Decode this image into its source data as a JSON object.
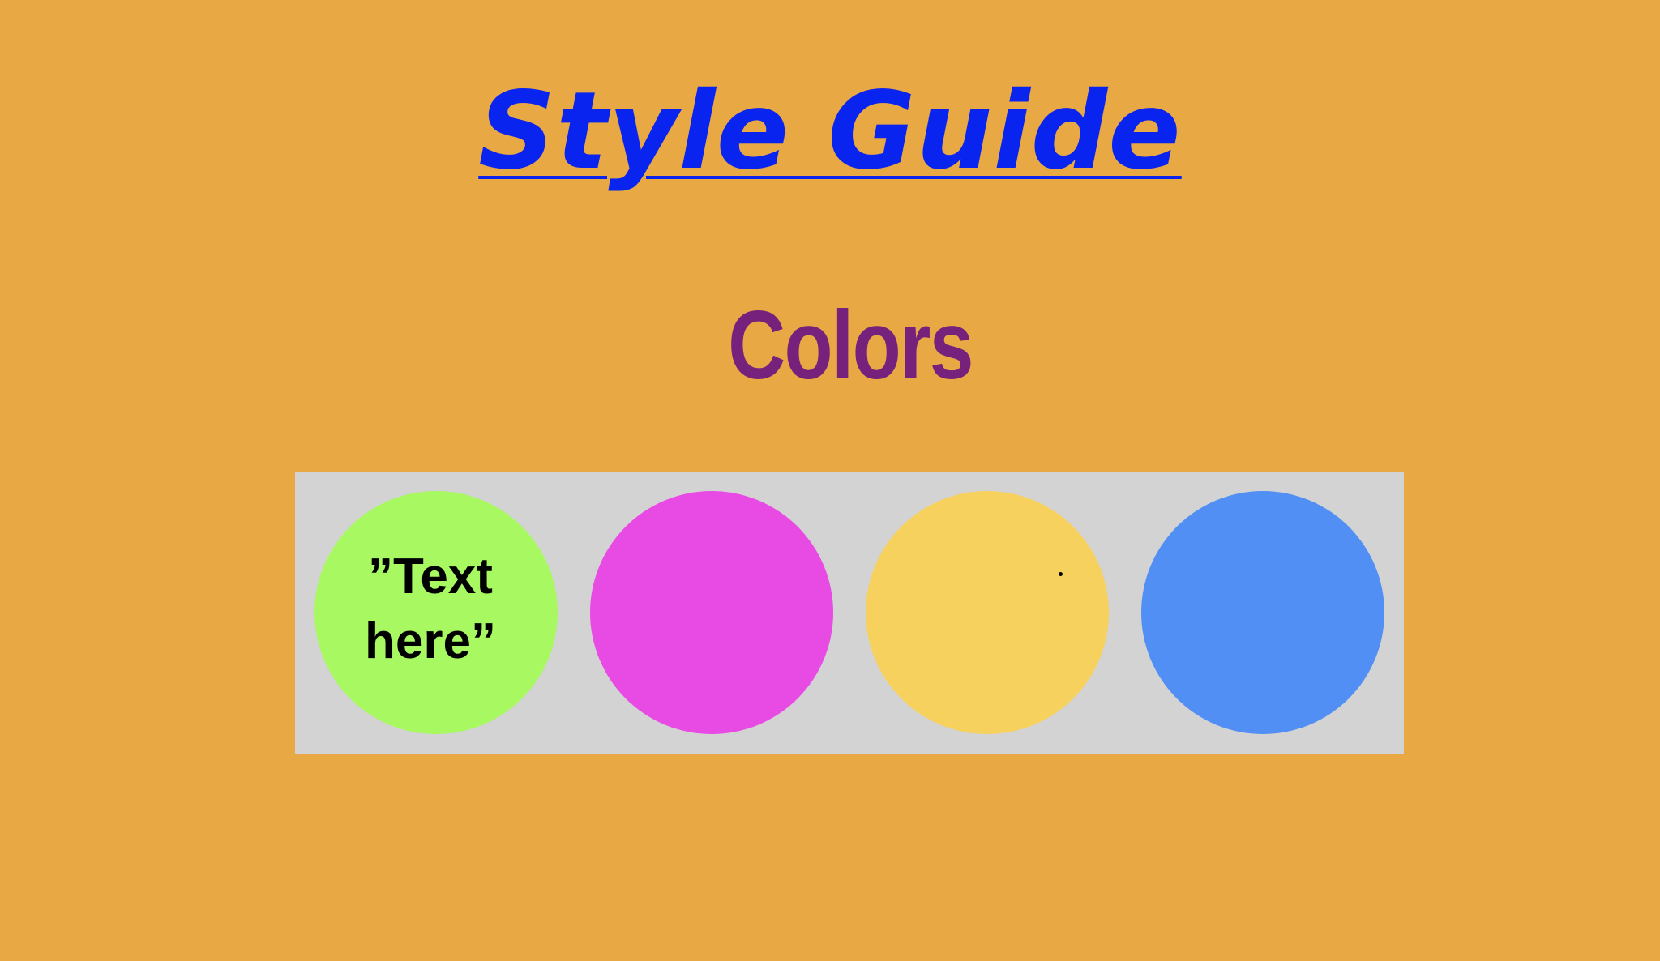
{
  "page": {
    "title": "Style Guide",
    "subtitle": "Colors",
    "background_color": "#E8A843",
    "panel_color": "#D3D3D3"
  },
  "swatches": [
    {
      "color": "#A8F862",
      "text": "”Text here”"
    },
    {
      "color": "#E84AE4",
      "text": ""
    },
    {
      "color": "#F7D15E",
      "text": ""
    },
    {
      "color": "#528FF5",
      "text": ""
    }
  ]
}
